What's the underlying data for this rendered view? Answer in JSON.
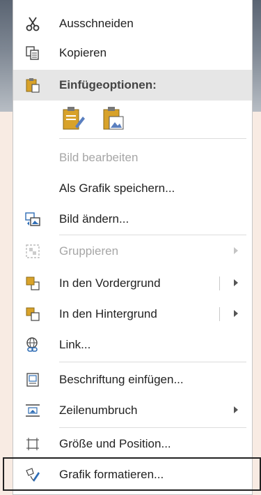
{
  "menu": {
    "items": [
      {
        "label": "Ausschneiden",
        "icon": "scissors-icon",
        "enabled": true
      },
      {
        "label": "Kopieren",
        "icon": "copy-icon",
        "enabled": true
      },
      {
        "label": "Einfügeoptionen:",
        "icon": "clipboard-icon",
        "enabled": true
      },
      {
        "label": "Bild bearbeiten",
        "icon": "",
        "enabled": false
      },
      {
        "label": "Als Grafik speichern...",
        "icon": "",
        "enabled": true
      },
      {
        "label": "Bild ändern...",
        "icon": "change-picture-icon",
        "enabled": true
      },
      {
        "label": "Gruppieren",
        "icon": "group-icon",
        "enabled": false
      },
      {
        "label": "In den Vordergrund",
        "icon": "bring-forward-icon",
        "enabled": true
      },
      {
        "label": "In den Hintergrund",
        "icon": "send-backward-icon",
        "enabled": true
      },
      {
        "label": "Link...",
        "icon": "link-icon",
        "enabled": true
      },
      {
        "label": "Beschriftung einfügen...",
        "icon": "caption-icon",
        "enabled": true
      },
      {
        "label": "Zeilenumbruch",
        "icon": "wrap-text-icon",
        "enabled": true
      },
      {
        "label": "Größe und Position...",
        "icon": "size-position-icon",
        "enabled": true
      },
      {
        "label": "Grafik formatieren...",
        "icon": "format-picture-icon",
        "enabled": true
      }
    ],
    "paste_options": [
      "keep-formatting-icon",
      "picture-paste-icon"
    ]
  },
  "colors": {
    "accent": "#d8a22a",
    "highlight": "#e6e6e6",
    "disabled_text": "#a6a6a6"
  }
}
